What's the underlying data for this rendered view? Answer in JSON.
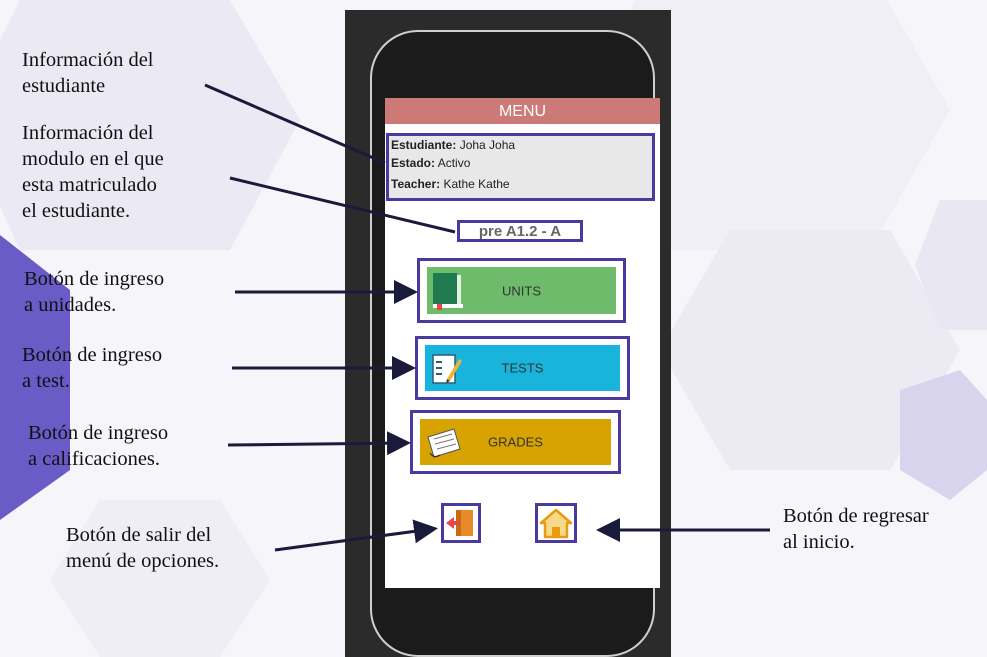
{
  "app": {
    "menu_title": "MENU",
    "student_label": "Estudiante:",
    "student_name": "Joha Joha",
    "status_label": "Estado:",
    "status_value": "Activo",
    "teacher_label": "Teacher:",
    "teacher_name": "Kathe Kathe",
    "module_code": "pre A1.2 - A",
    "buttons": {
      "units": "UNITS",
      "tests": "TESTS",
      "grades": "GRADES"
    }
  },
  "annotations": {
    "student_info": "Información del\nestudiante",
    "module_info": "Información del\nmodulo en el que\nesta matriculado\nel estudiante.",
    "units_button": "Botón de ingreso\na unidades.",
    "tests_button": "Botón de ingreso\na test.",
    "grades_button": "Botón de ingreso\na calificaciones.",
    "exit_button": "Botón de salir del\nmenú de opciones.",
    "home_button": "Botón de regresar\nal inicio."
  },
  "colors": {
    "menu_bar": "#cc7a78",
    "units": "#6dbb6b",
    "tests": "#19b4dc",
    "grades": "#d6a300",
    "outline": "#4a3aa0",
    "home_icon": "#f0a020",
    "exit_icon": "#e98a2a"
  },
  "icons": [
    "book-icon",
    "test-notepad-icon",
    "grades-paper-icon",
    "exit-door-icon",
    "home-icon"
  ]
}
